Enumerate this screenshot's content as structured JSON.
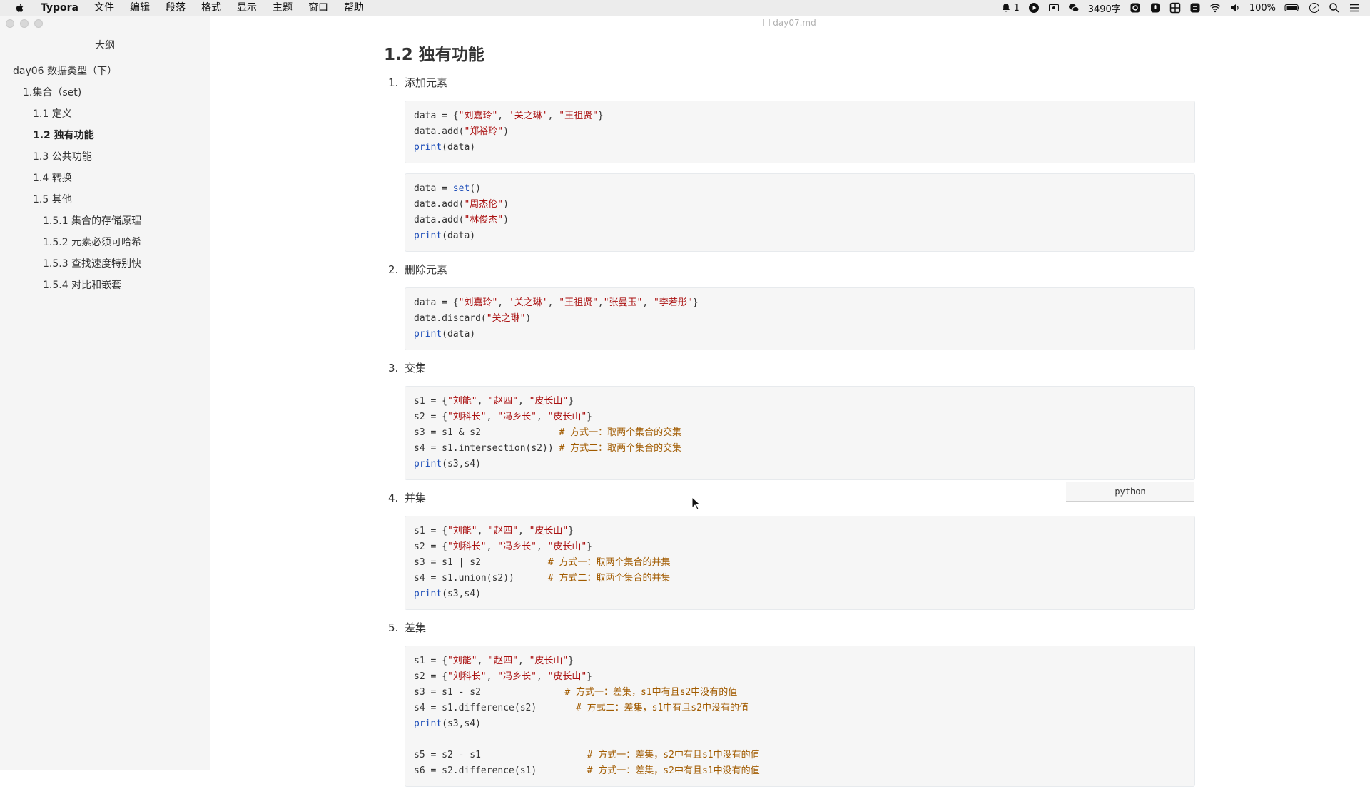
{
  "menubar": {
    "app_name": "Typora",
    "items": [
      "文件",
      "编辑",
      "段落",
      "格式",
      "显示",
      "主题",
      "窗口",
      "帮助"
    ],
    "status": {
      "notification_count": "1",
      "word_count": "3490字",
      "battery": "100%"
    }
  },
  "window": {
    "file_name": "day07.md"
  },
  "sidebar": {
    "title": "大纲",
    "items": [
      {
        "label": "day06 数据类型（下）",
        "level": 1
      },
      {
        "label": "1.集合（set)",
        "level": 2
      },
      {
        "label": "1.1 定义",
        "level": 3
      },
      {
        "label": "1.2 独有功能",
        "level": 3,
        "active": true
      },
      {
        "label": "1.3 公共功能",
        "level": 3
      },
      {
        "label": "1.4 转换",
        "level": 3
      },
      {
        "label": "1.5 其他",
        "level": 3
      },
      {
        "label": "1.5.1 集合的存储原理",
        "level": 4
      },
      {
        "label": "1.5.2 元素必须可哈希",
        "level": 4
      },
      {
        "label": "1.5.3 查找速度特别快",
        "level": 4
      },
      {
        "label": "1.5.4 对比和嵌套",
        "level": 4
      }
    ]
  },
  "editor": {
    "heading": "1.2 独有功能",
    "language_tag": "python",
    "sections": [
      {
        "num": "1.",
        "title": "添加元素",
        "blocks": [
          [
            [
              [
                "t",
                "data = {"
              ],
              [
                "s",
                "\"刘嘉玲\""
              ],
              [
                "t",
                ", "
              ],
              [
                "s",
                "'关之琳'"
              ],
              [
                "t",
                ", "
              ],
              [
                "s",
                "\"王祖贤\""
              ],
              [
                "t",
                "}"
              ]
            ],
            [
              [
                "t",
                "data.add("
              ],
              [
                "s",
                "\"郑裕玲\""
              ],
              [
                "t",
                ")"
              ]
            ],
            [
              [
                "k",
                "print"
              ],
              [
                "t",
                "(data)"
              ]
            ]
          ],
          [
            [
              [
                "t",
                "data = "
              ],
              [
                "k",
                "set"
              ],
              [
                "t",
                "()"
              ]
            ],
            [
              [
                "t",
                "data.add("
              ],
              [
                "s",
                "\"周杰伦\""
              ],
              [
                "t",
                ")"
              ]
            ],
            [
              [
                "t",
                "data.add("
              ],
              [
                "s",
                "\"林俊杰\""
              ],
              [
                "t",
                ")"
              ]
            ],
            [
              [
                "k",
                "print"
              ],
              [
                "t",
                "(data)"
              ]
            ]
          ]
        ]
      },
      {
        "num": "2.",
        "title": "删除元素",
        "blocks": [
          [
            [
              [
                "t",
                "data = {"
              ],
              [
                "s",
                "\"刘嘉玲\""
              ],
              [
                "t",
                ", "
              ],
              [
                "s",
                "'关之琳'"
              ],
              [
                "t",
                ", "
              ],
              [
                "s",
                "\"王祖贤\""
              ],
              [
                "t",
                ","
              ],
              [
                "s",
                "\"张曼玉\""
              ],
              [
                "t",
                ", "
              ],
              [
                "s",
                "\"李若彤\""
              ],
              [
                "t",
                "}"
              ]
            ],
            [
              [
                "t",
                "data.discard("
              ],
              [
                "s",
                "\"关之琳\""
              ],
              [
                "t",
                ")"
              ]
            ],
            [
              [
                "k",
                "print"
              ],
              [
                "t",
                "(data)"
              ]
            ]
          ]
        ]
      },
      {
        "num": "3.",
        "title": "交集",
        "has_lang_tag": true,
        "blocks": [
          [
            [
              [
                "t",
                "s1 = {"
              ],
              [
                "s",
                "\"刘能\""
              ],
              [
                "t",
                ", "
              ],
              [
                "s",
                "\"赵四\""
              ],
              [
                "t",
                ", "
              ],
              [
                "s",
                "\"皮长山\""
              ],
              [
                "t",
                "}"
              ]
            ],
            [
              [
                "t",
                "s2 = {"
              ],
              [
                "s",
                "\"刘科长\""
              ],
              [
                "t",
                ", "
              ],
              [
                "s",
                "\"冯乡长\""
              ],
              [
                "t",
                ", "
              ],
              [
                "s",
                "\"皮长山\""
              ],
              [
                "t",
                "}"
              ]
            ],
            [
              [
                "t",
                "s3 = s1 & s2              "
              ],
              [
                "c",
                "# 方式一：取两个集合的交集"
              ]
            ],
            [
              [
                "t",
                "s4 = s1.intersection(s2)) "
              ],
              [
                "c",
                "# 方式二：取两个集合的交集"
              ]
            ],
            [
              [
                "k",
                "print"
              ],
              [
                "t",
                "(s3,s4)"
              ]
            ]
          ]
        ]
      },
      {
        "num": "4.",
        "title": "并集",
        "blocks": [
          [
            [
              [
                "t",
                "s1 = {"
              ],
              [
                "s",
                "\"刘能\""
              ],
              [
                "t",
                ", "
              ],
              [
                "s",
                "\"赵四\""
              ],
              [
                "t",
                ", "
              ],
              [
                "s",
                "\"皮长山\""
              ],
              [
                "t",
                "}"
              ]
            ],
            [
              [
                "t",
                "s2 = {"
              ],
              [
                "s",
                "\"刘科长\""
              ],
              [
                "t",
                ", "
              ],
              [
                "s",
                "\"冯乡长\""
              ],
              [
                "t",
                ", "
              ],
              [
                "s",
                "\"皮长山\""
              ],
              [
                "t",
                "}"
              ]
            ],
            [
              [
                "t",
                "s3 = s1 | s2            "
              ],
              [
                "c",
                "# 方式一：取两个集合的并集"
              ]
            ],
            [
              [
                "t",
                "s4 = s1.union(s2))      "
              ],
              [
                "c",
                "# 方式二：取两个集合的并集"
              ]
            ],
            [
              [
                "k",
                "print"
              ],
              [
                "t",
                "(s3,s4)"
              ]
            ]
          ]
        ]
      },
      {
        "num": "5.",
        "title": "差集",
        "blocks": [
          [
            [
              [
                "t",
                "s1 = {"
              ],
              [
                "s",
                "\"刘能\""
              ],
              [
                "t",
                ", "
              ],
              [
                "s",
                "\"赵四\""
              ],
              [
                "t",
                ", "
              ],
              [
                "s",
                "\"皮长山\""
              ],
              [
                "t",
                "}"
              ]
            ],
            [
              [
                "t",
                "s2 = {"
              ],
              [
                "s",
                "\"刘科长\""
              ],
              [
                "t",
                ", "
              ],
              [
                "s",
                "\"冯乡长\""
              ],
              [
                "t",
                ", "
              ],
              [
                "s",
                "\"皮长山\""
              ],
              [
                "t",
                "}"
              ]
            ],
            [
              [
                "t",
                "s3 = s1 - s2               "
              ],
              [
                "c",
                "# 方式一：差集，s1中有且s2中没有的值"
              ]
            ],
            [
              [
                "t",
                "s4 = s1.difference(s2)       "
              ],
              [
                "c",
                "# 方式二：差集，s1中有且s2中没有的值"
              ]
            ],
            [
              [
                "k",
                "print"
              ],
              [
                "t",
                "(s3,s4)"
              ]
            ],
            [
              [
                "t",
                ""
              ]
            ],
            [
              [
                "t",
                "s5 = s2 - s1                   "
              ],
              [
                "c",
                "# 方式一：差集，s2中有且s1中没有的值"
              ]
            ],
            [
              [
                "t",
                "s6 = s2.difference(s1)         "
              ],
              [
                "c",
                "# 方式一：差集，s2中有且s1中没有的值"
              ]
            ]
          ]
        ]
      }
    ]
  }
}
